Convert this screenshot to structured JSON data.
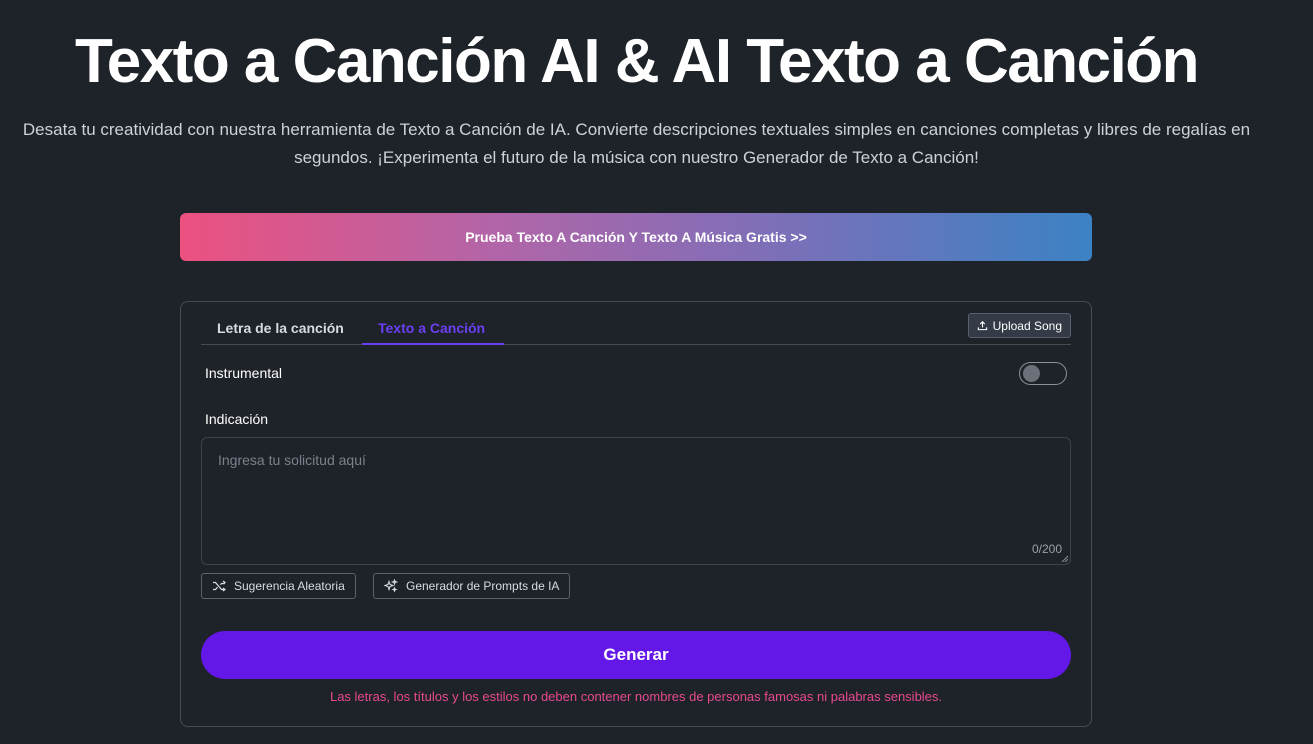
{
  "hero": {
    "title": "Texto a Canción AI & AI Texto a Canción",
    "subtitle": "Desata tu creatividad con nuestra herramienta de Texto a Canción de IA. Convierte descripciones textuales simples en canciones completas y libres de regalías en segundos. ¡Experimenta el futuro de la música con nuestro Generador de Texto a Canción!"
  },
  "banner": {
    "label": "Prueba Texto A Canción Y Texto A Música Gratis >>"
  },
  "tabs": [
    {
      "label": "Letra de la canción",
      "active": false
    },
    {
      "label": "Texto a Canción",
      "active": true
    }
  ],
  "upload": {
    "label": "Upload Song",
    "icon": "upload-icon"
  },
  "instrumental": {
    "label": "Instrumental",
    "enabled": false
  },
  "prompt": {
    "label": "Indicación",
    "placeholder": "Ingresa tu solicitud aquí",
    "value": "",
    "counter": "0/200"
  },
  "suggestions": {
    "random": {
      "label": "Sugerencia Aleatoria",
      "icon": "shuffle-icon"
    },
    "ai": {
      "label": "Generador de Prompts de IA",
      "icon": "sparkles-icon"
    }
  },
  "generate": {
    "label": "Generar"
  },
  "warning": "Las letras, los títulos y los estilos no deben contener nombres de personas famosas ni palabras sensibles.",
  "colors": {
    "background": "#1e2229",
    "accent": "#6418e8",
    "tab_active": "#6b3ff2",
    "warning": "#e84a8e",
    "banner_start": "#ec5180",
    "banner_end": "#3b82c4"
  }
}
